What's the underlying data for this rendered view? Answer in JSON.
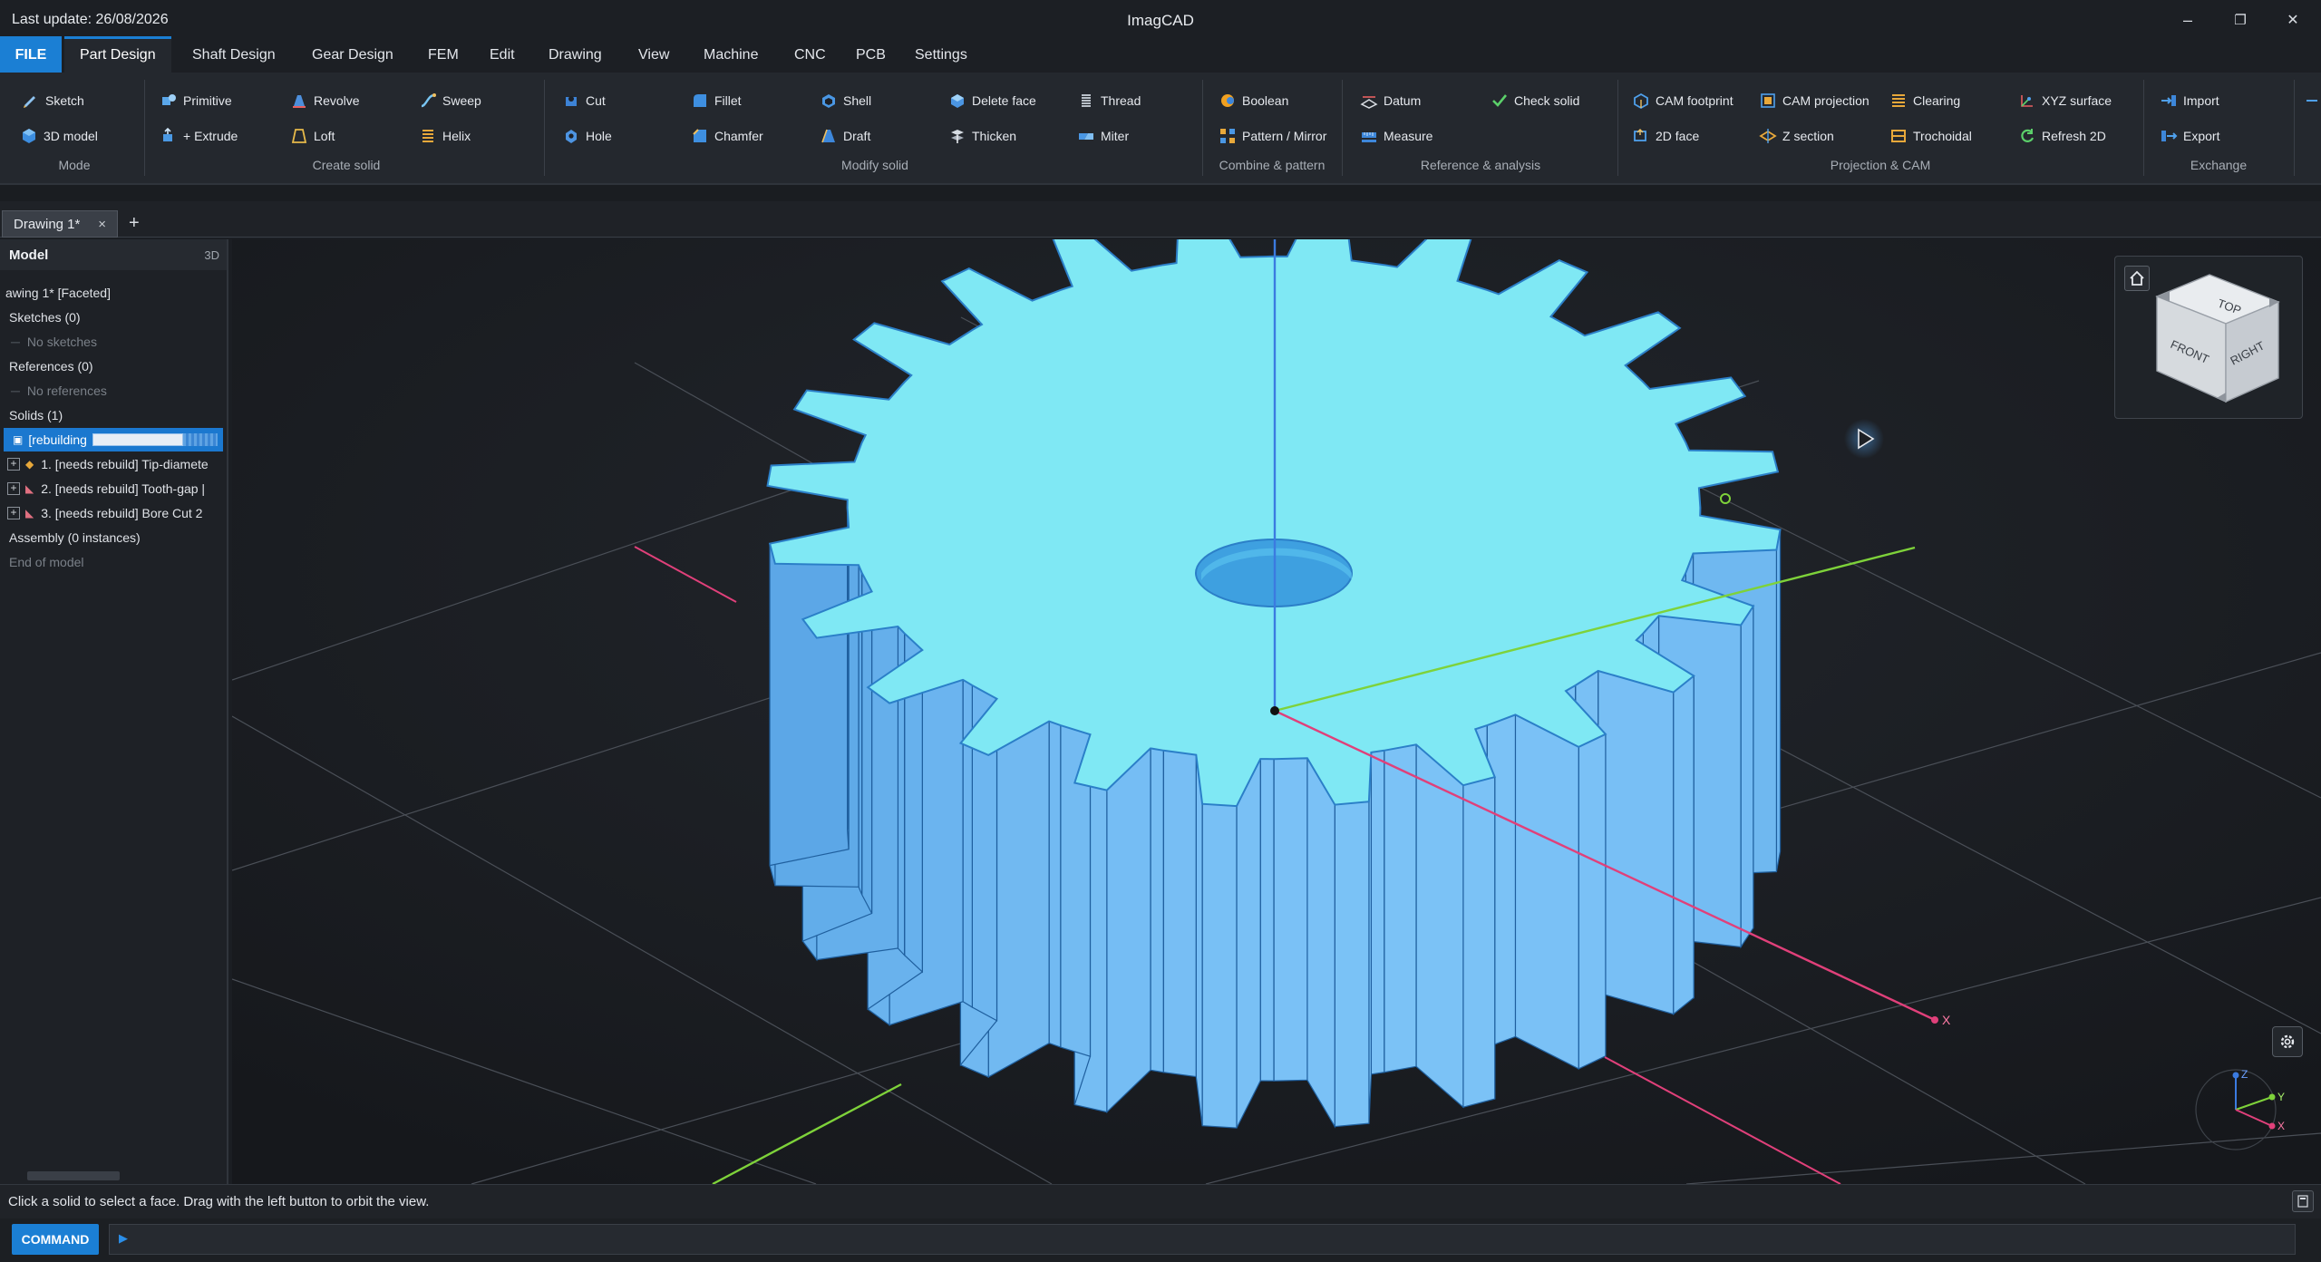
{
  "window": {
    "last_update": "Last update: 26/08/2026",
    "title": "ImagCAD",
    "minimize": "–",
    "restore": "❐",
    "close": "✕"
  },
  "menu": {
    "file": "FILE",
    "items": [
      "Part Design",
      "Shaft Design",
      "Gear Design",
      "FEM",
      "Edit",
      "Drawing",
      "View",
      "Machine",
      "CNC",
      "PCB",
      "Settings"
    ],
    "active": "Part Design"
  },
  "ribbon": {
    "mode": {
      "label": "Mode",
      "sketch": "Sketch",
      "model3d": "3D model"
    },
    "create": {
      "label": "Create solid",
      "primitive": "Primitive",
      "extrude": "+ Extrude",
      "revolve": "Revolve",
      "loft": "Loft",
      "sweep": "Sweep",
      "helix": "Helix"
    },
    "modify": {
      "label": "Modify solid",
      "cut": "Cut",
      "hole": "Hole",
      "fillet": "Fillet",
      "chamfer": "Chamfer",
      "shell": "Shell",
      "draft": "Draft",
      "delete_face": "Delete face",
      "thicken": "Thicken",
      "thread": "Thread",
      "miter": "Miter"
    },
    "combine": {
      "label": "Combine & pattern",
      "boolean": "Boolean",
      "pattern": "Pattern / Mirror"
    },
    "reference": {
      "label": "Reference & analysis",
      "datum": "Datum",
      "measure": "Measure",
      "check": "Check solid"
    },
    "cam": {
      "label": "Projection & CAM",
      "footprint": "CAM footprint",
      "face2d": "2D face",
      "projection": "CAM projection",
      "zsection": "Z section",
      "clearing": "Clearing",
      "trochoidal": "Trochoidal",
      "xyz": "XYZ surface",
      "refresh": "Refresh 2D"
    },
    "exchange": {
      "label": "Exchange",
      "import": "Import",
      "export": "Export"
    }
  },
  "tabs": {
    "doc": "Drawing 1*",
    "close": "×",
    "add": "+"
  },
  "model": {
    "title": "Model",
    "mode": "3D",
    "rows": [
      {
        "text": "awing 1*  [Faceted]",
        "style": ""
      },
      {
        "text": "Sketches (0)",
        "style": ""
      },
      {
        "text": "No sketches",
        "style": "dim"
      },
      {
        "text": "References (0)",
        "style": ""
      },
      {
        "text": "No references",
        "style": "dim"
      },
      {
        "text": "Solids (1)",
        "style": ""
      }
    ],
    "rebuilding": "[rebuilding",
    "features": [
      "1. [needs rebuild] Tip-diamete",
      "2. [needs rebuild] Tooth-gap |",
      "3. [needs rebuild] Bore  Cut  2"
    ],
    "assembly": "Assembly (0 instances)",
    "end": "End of model"
  },
  "viewcube": {
    "top": "TOP",
    "front": "FRONT",
    "right": "RIGHT"
  },
  "axes": {
    "x": "X",
    "y": "Y",
    "z": "Z"
  },
  "status": {
    "message": "Click a solid to select a face. Drag with the left button to orbit the view."
  },
  "command": {
    "button": "COMMAND",
    "prompt": "▶",
    "value": ""
  },
  "colors": {
    "accent": "#1b7fd4",
    "gear": "#7fe8f4",
    "gear_side": "#4aa7e6",
    "x_axis": "#e0407a",
    "y_axis": "#7ed23a",
    "z_axis": "#3b7be0"
  }
}
